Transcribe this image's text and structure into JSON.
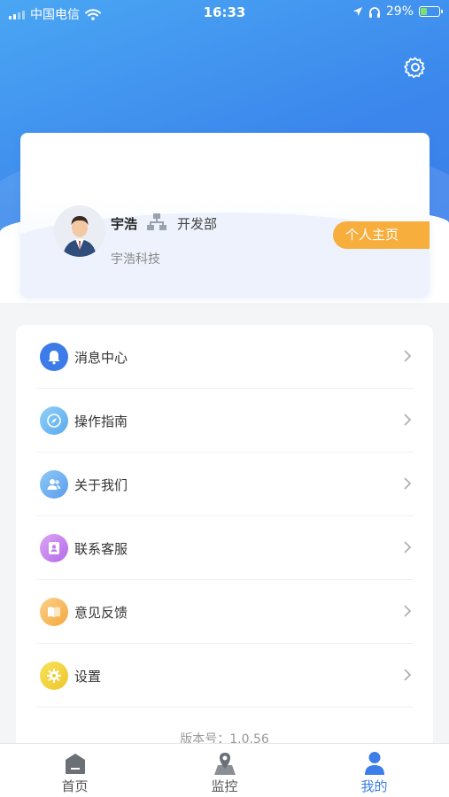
{
  "status_bar": {
    "carrier": "中国电信",
    "time": "16:33",
    "battery": "29%"
  },
  "header": {
    "settings_icon": "gear-icon"
  },
  "profile": {
    "name": "宇浩",
    "department": "开发部",
    "company": "宇浩科技",
    "home_button": "个人主页",
    "home_button_color": "#f7ae3d"
  },
  "menu": {
    "items": [
      {
        "label": "消息中心",
        "icon": "bell-icon",
        "color": "#3d7be8"
      },
      {
        "label": "操作指南",
        "icon": "compass-icon",
        "color": "#6cb9f1"
      },
      {
        "label": "关于我们",
        "icon": "users-icon",
        "color": "#6aa9f0"
      },
      {
        "label": "联系客服",
        "icon": "contact-icon",
        "color": "#c984ef"
      },
      {
        "label": "意见反馈",
        "icon": "book-icon",
        "color": "#f7b95a"
      },
      {
        "label": "设置",
        "icon": "gear-icon",
        "color": "#f2d23c"
      }
    ],
    "version": "版本号：1.0.56"
  },
  "tab_bar": {
    "tabs": [
      {
        "label": "首页",
        "icon": "home-icon",
        "active": false
      },
      {
        "label": "监控",
        "icon": "map-pin-icon",
        "active": false
      },
      {
        "label": "我的",
        "icon": "user-icon",
        "active": true
      }
    ],
    "active_color": "#3b7de9"
  }
}
